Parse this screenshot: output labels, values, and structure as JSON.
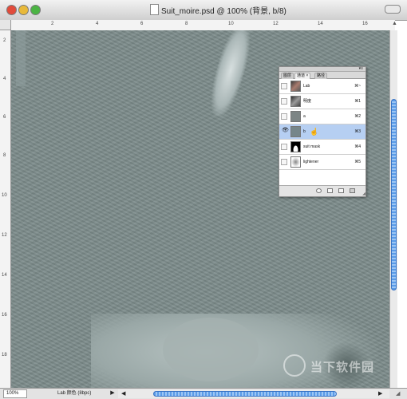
{
  "window": {
    "title": "Suit_moire.psd @ 100% (背景, b/8)"
  },
  "rulers": {
    "top_ticks": [
      "2",
      "4",
      "6",
      "8",
      "10",
      "12",
      "14",
      "16"
    ],
    "left_ticks": [
      "2",
      "4",
      "6",
      "8",
      "10",
      "12",
      "14",
      "16",
      "18"
    ]
  },
  "status": {
    "zoom": "100%",
    "doc_info": "Lab 颜色 (8bpc)"
  },
  "panel": {
    "tabs": [
      {
        "label": "图层",
        "active": false
      },
      {
        "label": "通道 ×",
        "active": true
      },
      {
        "label": "路径",
        "active": false
      }
    ],
    "channels": [
      {
        "name": "Lab",
        "shortcut": "⌘~",
        "visible": false,
        "selected": false
      },
      {
        "name": "明度",
        "shortcut": "⌘1",
        "visible": false,
        "selected": false
      },
      {
        "name": "a",
        "shortcut": "⌘2",
        "visible": false,
        "selected": false
      },
      {
        "name": "b",
        "shortcut": "⌘3",
        "visible": true,
        "selected": true
      },
      {
        "name": "suit mask",
        "shortcut": "⌘4",
        "visible": false,
        "selected": false
      },
      {
        "name": "lightener",
        "shortcut": "⌘5",
        "visible": false,
        "selected": false
      }
    ]
  },
  "watermark": {
    "text": "当下软件园"
  },
  "colors": {
    "canvas": "#7c8b8a",
    "selection": "#b6cff2",
    "scroll_thumb": "#5a9ce8"
  },
  "icons": {
    "eye": "eye-icon",
    "hand_cursor": "hand-cursor-icon",
    "panel_menu": "panel-menu-icon"
  }
}
